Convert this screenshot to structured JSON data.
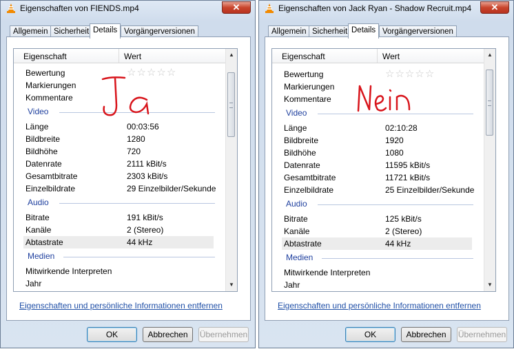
{
  "colors": {
    "section": "#1e3f9e",
    "link": "#1e4ea6",
    "handwriting": "#d8141b"
  },
  "dialogs": [
    {
      "title": "Eigenschaften von FIENDS.mp4",
      "close_label": "✕",
      "tabs": [
        "Allgemein",
        "Sicherheit",
        "Details",
        "Vorgängerversionen"
      ],
      "active_tab": "Details",
      "header": {
        "property": "Eigenschaft",
        "value": "Wert"
      },
      "top_rows": [
        "Bewertung",
        "Markierungen",
        "Kommentare"
      ],
      "sections": {
        "video": "Video",
        "audio": "Audio",
        "media": "Medien"
      },
      "video": [
        {
          "k": "Länge",
          "v": "00:03:56"
        },
        {
          "k": "Bildbreite",
          "v": "1280"
        },
        {
          "k": "Bildhöhe",
          "v": "720"
        },
        {
          "k": "Datenrate",
          "v": "2111 kBit/s"
        },
        {
          "k": "Gesamtbitrate",
          "v": "2303 kBit/s"
        },
        {
          "k": "Einzelbildrate",
          "v": "29 Einzelbilder/Sekunde"
        }
      ],
      "audio": [
        {
          "k": "Bitrate",
          "v": "191 kBit/s"
        },
        {
          "k": "Kanäle",
          "v": "2 (Stereo)"
        },
        {
          "k": "Abtastrate",
          "v": "44 kHz"
        }
      ],
      "media": [
        {
          "k": "Mitwirkende Interpreten",
          "v": ""
        },
        {
          "k": "Jahr",
          "v": ""
        }
      ],
      "link": "Eigenschaften und persönliche Informationen entfernen",
      "buttons": {
        "ok": "OK",
        "cancel": "Abbrechen",
        "apply": "Übernehmen"
      },
      "annotation": "Ja"
    },
    {
      "title": "Eigenschaften von Jack Ryan - Shadow Recruit.mp4",
      "close_label": "✕",
      "tabs": [
        "Allgemein",
        "Sicherheit",
        "Details",
        "Vorgängerversionen"
      ],
      "active_tab": "Details",
      "header": {
        "property": "Eigenschaft",
        "value": "Wert"
      },
      "top_rows": [
        "Bewertung",
        "Markierungen",
        "Kommentare"
      ],
      "sections": {
        "video": "Video",
        "audio": "Audio",
        "media": "Medien"
      },
      "video": [
        {
          "k": "Länge",
          "v": "02:10:28"
        },
        {
          "k": "Bildbreite",
          "v": "1920"
        },
        {
          "k": "Bildhöhe",
          "v": "1080"
        },
        {
          "k": "Datenrate",
          "v": "11595 kBit/s"
        },
        {
          "k": "Gesamtbitrate",
          "v": "11721 kBit/s"
        },
        {
          "k": "Einzelbildrate",
          "v": "25 Einzelbilder/Sekunde"
        }
      ],
      "audio": [
        {
          "k": "Bitrate",
          "v": "125 kBit/s"
        },
        {
          "k": "Kanäle",
          "v": "2 (Stereo)"
        },
        {
          "k": "Abtastrate",
          "v": "44 kHz"
        }
      ],
      "media": [
        {
          "k": "Mitwirkende Interpreten",
          "v": ""
        },
        {
          "k": "Jahr",
          "v": ""
        }
      ],
      "link": "Eigenschaften und persönliche Informationen entfernen",
      "buttons": {
        "ok": "OK",
        "cancel": "Abbrechen",
        "apply": "Übernehmen"
      },
      "annotation": "Nein"
    }
  ]
}
